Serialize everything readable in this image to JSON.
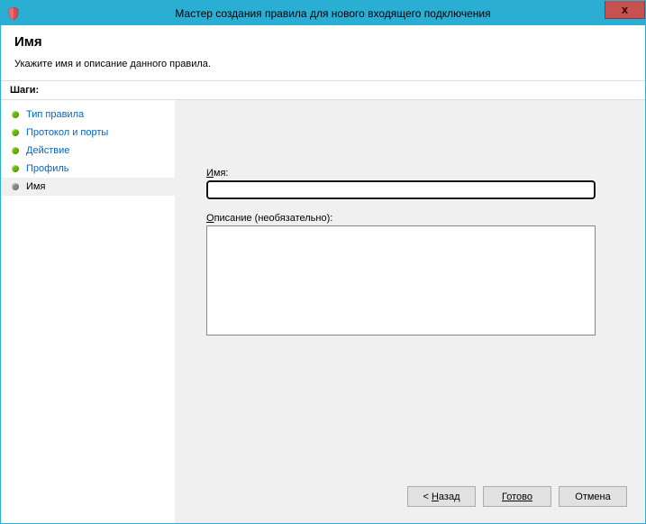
{
  "titlebar": {
    "title": "Мастер создания правила для нового входящего подключения"
  },
  "header": {
    "title": "Имя",
    "subtitle": "Укажите имя и описание данного правила."
  },
  "steps": {
    "header": "Шаги:",
    "items": [
      {
        "label": "Тип правила"
      },
      {
        "label": "Протокол и порты"
      },
      {
        "label": "Действие"
      },
      {
        "label": "Профиль"
      },
      {
        "label": "Имя"
      }
    ]
  },
  "form": {
    "name_label_prefix": "И",
    "name_label_rest": "мя:",
    "name_value": "",
    "desc_label_prefix": "О",
    "desc_label_rest": "писание (необязательно):",
    "desc_value": ""
  },
  "buttons": {
    "back_prefix": "< ",
    "back_u": "Н",
    "back_rest": "азад",
    "finish": "Готово",
    "cancel": "Отмена"
  }
}
